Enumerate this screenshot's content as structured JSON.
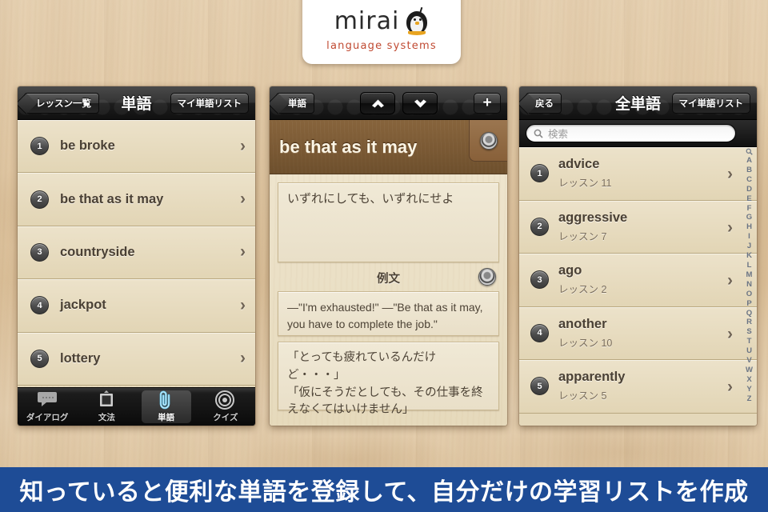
{
  "logo": {
    "word": "mirai",
    "tagline": "language systems",
    "icon": "penguin-icon"
  },
  "phone1": {
    "nav": {
      "back_label": "レッスン一覧",
      "title": "単語",
      "right_label": "マイ単語リスト"
    },
    "rows": [
      {
        "num": "1",
        "label": "be broke"
      },
      {
        "num": "2",
        "label": "be that as it may"
      },
      {
        "num": "3",
        "label": "countryside"
      },
      {
        "num": "4",
        "label": "jackpot"
      },
      {
        "num": "5",
        "label": "lottery"
      }
    ],
    "tabs": [
      {
        "label": "ダイアログ",
        "icon": "speech-bubble-icon",
        "active": false
      },
      {
        "label": "文法",
        "icon": "blackboard-icon",
        "active": false
      },
      {
        "label": "単語",
        "icon": "paperclip-icon",
        "active": true
      },
      {
        "label": "クイズ",
        "icon": "target-icon",
        "active": false
      }
    ]
  },
  "phone2": {
    "nav": {
      "back_label": "単語",
      "up_icon": "chevron-up-icon",
      "down_icon": "chevron-down-icon",
      "add_label": "+"
    },
    "word": "be that as it may",
    "speaker_icon": "speaker-icon",
    "meaning": "いずれにしても、いずれにせよ",
    "example_section_label": "例文",
    "example_en": "―\"I'm exhausted!\" ―\"Be that as it may, you have to complete the job.\"",
    "example_ja": "「とっても疲れているんだけど・・・」\n「仮にそうだとしても、その仕事を終えなくてはいけません」"
  },
  "phone3": {
    "nav": {
      "back_label": "戻る",
      "title": "全単語",
      "right_label": "マイ単語リスト"
    },
    "search": {
      "placeholder": "検索",
      "icon": "search-icon"
    },
    "rows": [
      {
        "num": "1",
        "word": "advice",
        "lesson": "レッスン 11"
      },
      {
        "num": "2",
        "word": "aggressive",
        "lesson": "レッスン 7"
      },
      {
        "num": "3",
        "word": "ago",
        "lesson": "レッスン 2"
      },
      {
        "num": "4",
        "word": "another",
        "lesson": "レッスン 10"
      },
      {
        "num": "5",
        "word": "apparently",
        "lesson": "レッスン 5"
      }
    ],
    "index": [
      "A",
      "B",
      "C",
      "D",
      "E",
      "F",
      "G",
      "H",
      "I",
      "J",
      "K",
      "L",
      "M",
      "N",
      "O",
      "P",
      "Q",
      "R",
      "S",
      "T",
      "U",
      "V",
      "W",
      "X",
      "Y",
      "Z"
    ]
  },
  "banner": {
    "text": "知っていると便利な単語を登録して、自分だけの学習リストを作成",
    "color": "#1e4c96"
  }
}
